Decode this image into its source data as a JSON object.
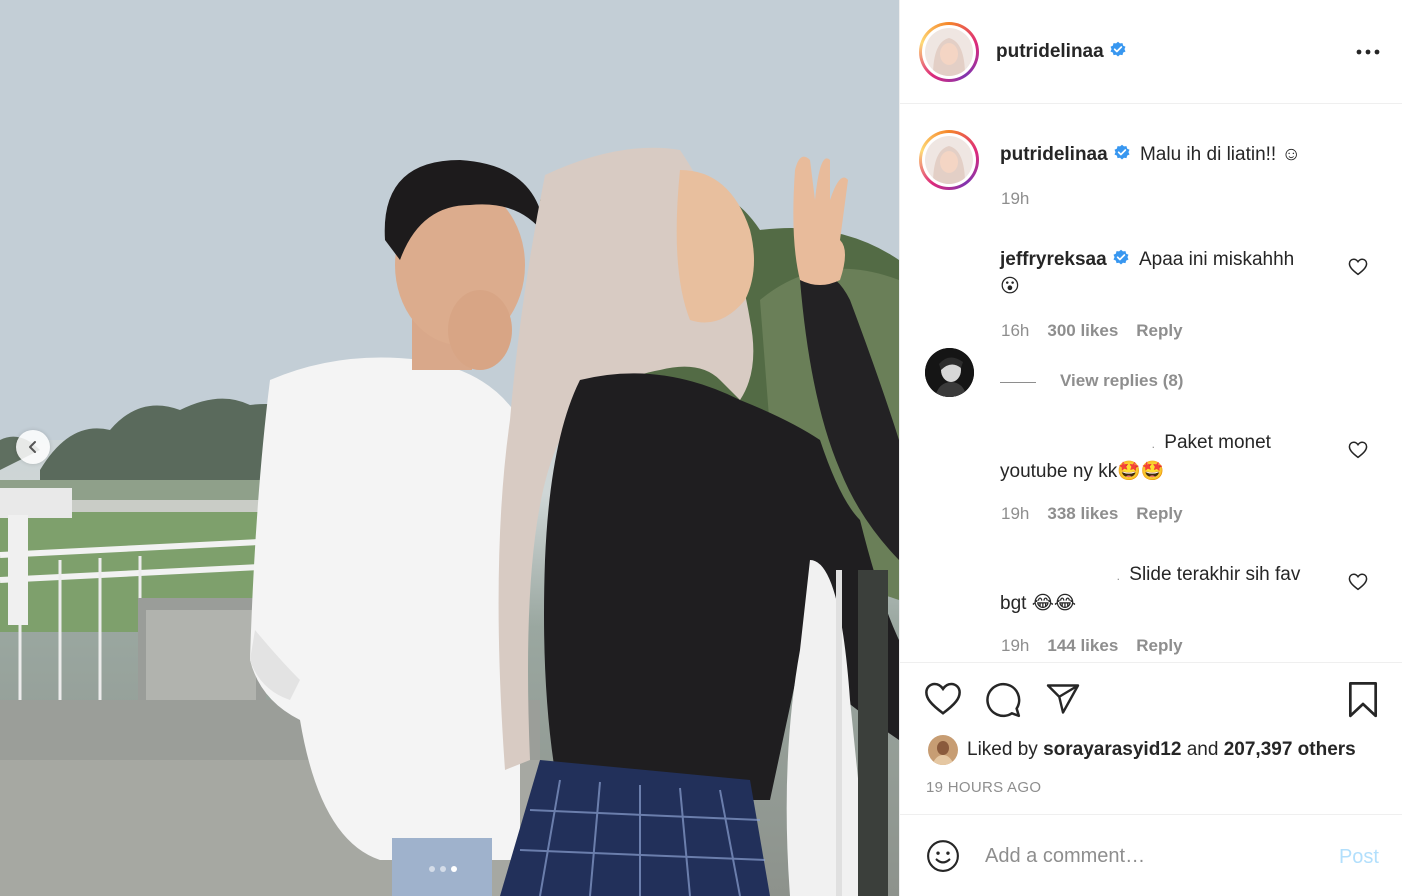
{
  "post": {
    "username": "putridelinaa",
    "more_icon": "more-horizontal-icon",
    "caption": {
      "username": "putridelinaa",
      "text": "Malu ih di liatin!! ☺",
      "time": "19h"
    },
    "carousel": {
      "total": 3,
      "active": 3
    }
  },
  "comments": [
    {
      "username": "jeffryreksaa",
      "verified": true,
      "text_line1": "Apaa ini miskahhh",
      "text_line2": "😮",
      "time": "16h",
      "likes": "300 likes",
      "reply": "Reply",
      "view_replies": "View replies (8)"
    },
    {
      "username": ".",
      "text_line1": "Paket monet",
      "text_line2": "youtube ny kk🤩🤩",
      "time": "19h",
      "likes": "338 likes",
      "reply": "Reply"
    },
    {
      "username": ".",
      "text_line1": "Slide terakhir sih fav",
      "text_line2": "bgt 😂😂",
      "time": "19h",
      "likes": "144 likes",
      "reply": "Reply"
    }
  ],
  "likes": {
    "prefix": "Liked by",
    "user": "sorayarasyid12",
    "and": "and",
    "others": "207,397 others"
  },
  "timestamp": "19 HOURS AGO",
  "comment_box": {
    "placeholder": "Add a comment…",
    "post_label": "Post"
  },
  "colors": {
    "text": "#262626",
    "secondary": "#8e8e8e",
    "verified": "#3897f0",
    "post_disabled": "#b2dffc",
    "border": "#efefef"
  }
}
